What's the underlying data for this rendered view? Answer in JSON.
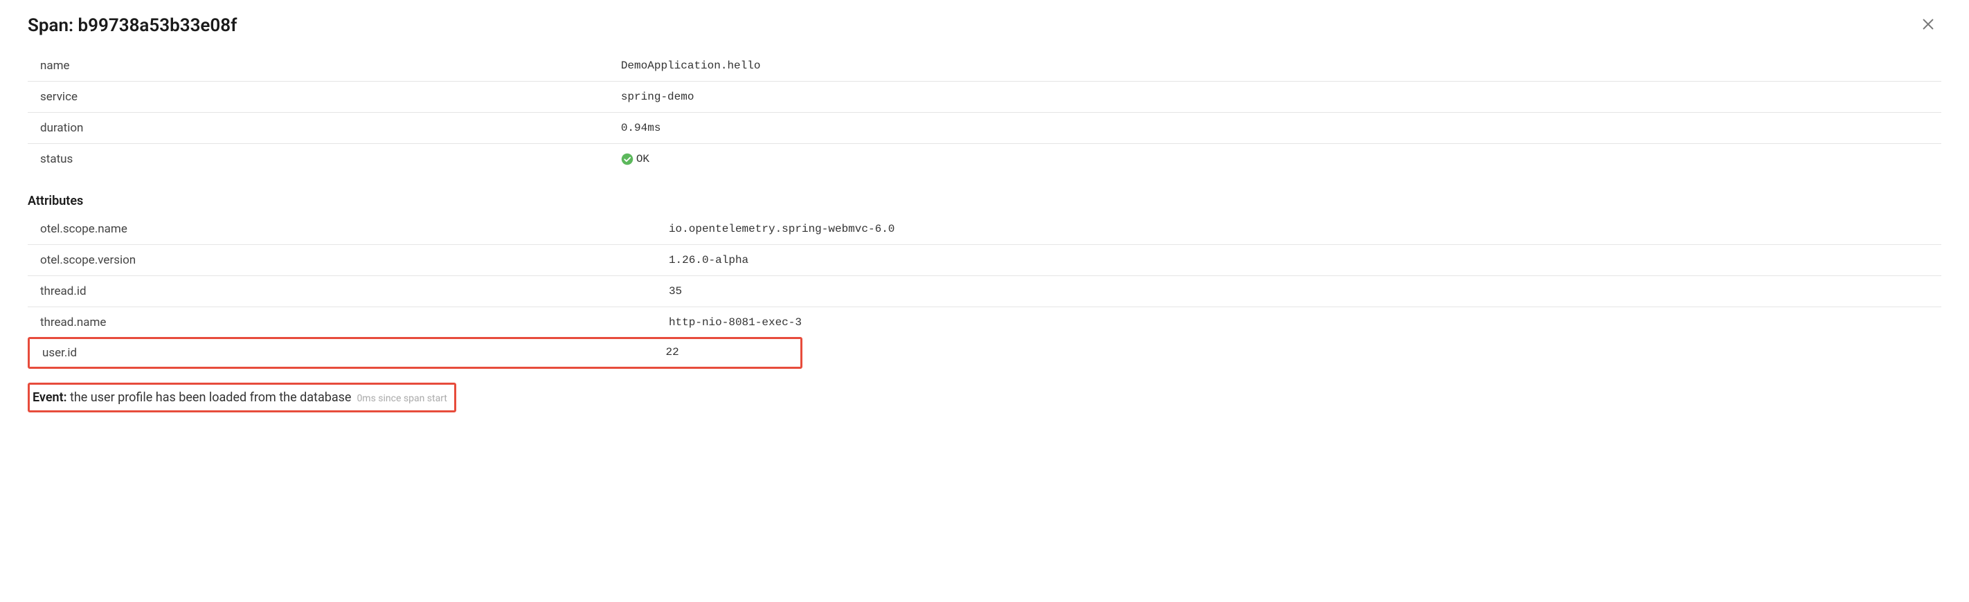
{
  "header": {
    "title_prefix": "Span: ",
    "span_id": "b99738a53b33e08f"
  },
  "details": {
    "name": {
      "key": "name",
      "value": "DemoApplication.hello"
    },
    "service": {
      "key": "service",
      "value": "spring-demo"
    },
    "duration": {
      "key": "duration",
      "value": "0.94ms"
    },
    "status": {
      "key": "status",
      "value": "OK"
    }
  },
  "attributes_heading": "Attributes",
  "attributes": {
    "scope_name": {
      "key": "otel.scope.name",
      "value": "io.opentelemetry.spring-webmvc-6.0"
    },
    "scope_version": {
      "key": "otel.scope.version",
      "value": "1.26.0-alpha"
    },
    "thread_id": {
      "key": "thread.id",
      "value": "35"
    },
    "thread_name": {
      "key": "thread.name",
      "value": "http-nio-8081-exec-3"
    },
    "user_id": {
      "key": "user.id",
      "value": "22"
    }
  },
  "event": {
    "label": "Event:",
    "text": " the user profile has been loaded from the database",
    "time": "0ms since span start"
  }
}
